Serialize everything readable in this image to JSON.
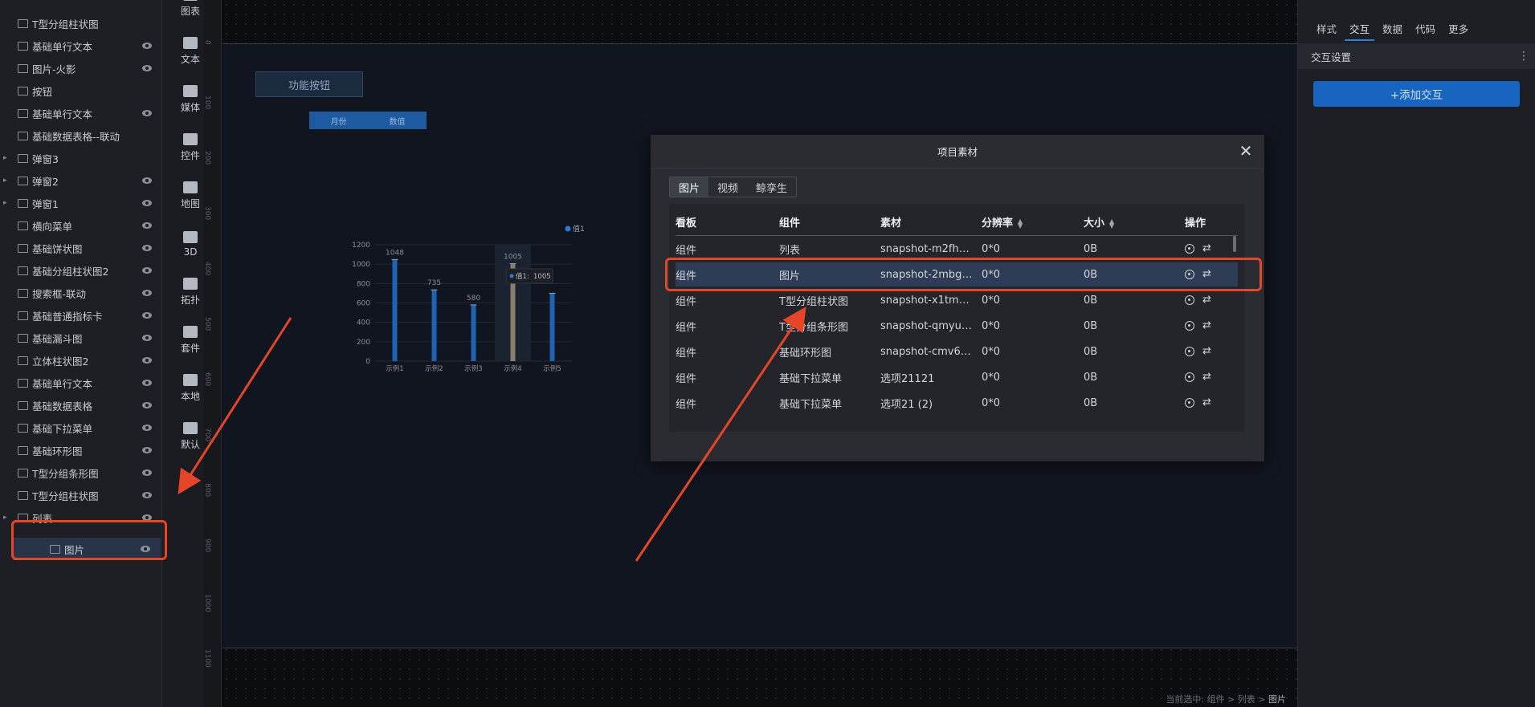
{
  "layers": [
    {
      "label": "T型分组柱状图",
      "icon": "bar-chart-icon",
      "eye": false,
      "caret": false
    },
    {
      "label": "基础单行文本",
      "icon": "text-icon",
      "eye": true,
      "caret": false
    },
    {
      "label": "图片-火影",
      "icon": "image-icon",
      "eye": true,
      "caret": false
    },
    {
      "label": "按钮",
      "icon": "button-icon",
      "eye": false,
      "caret": false
    },
    {
      "label": "基础单行文本",
      "icon": "text-icon",
      "eye": true,
      "caret": false
    },
    {
      "label": "基础数据表格--联动",
      "icon": "table-icon",
      "eye": false,
      "caret": false
    },
    {
      "label": "弹窗3",
      "icon": "folder-icon",
      "eye": false,
      "caret": true
    },
    {
      "label": "弹窗2",
      "icon": "folder-icon",
      "eye": true,
      "caret": true
    },
    {
      "label": "弹窗1",
      "icon": "folder-icon",
      "eye": true,
      "caret": true
    },
    {
      "label": "横向菜单",
      "icon": "menu-icon",
      "eye": true,
      "caret": false
    },
    {
      "label": "基础饼状图",
      "icon": "pie-chart-icon",
      "eye": true,
      "caret": false
    },
    {
      "label": "基础分组柱状图2",
      "icon": "bar-chart-icon",
      "eye": true,
      "caret": false
    },
    {
      "label": "搜索框-联动",
      "icon": "search-box-icon",
      "eye": true,
      "caret": false
    },
    {
      "label": "基础普通指标卡",
      "icon": "indicator-card-icon",
      "eye": true,
      "caret": false
    },
    {
      "label": "基础漏斗图",
      "icon": "funnel-chart-icon",
      "eye": true,
      "caret": false
    },
    {
      "label": "立体柱状图2",
      "icon": "3d-bar-icon",
      "eye": true,
      "caret": false
    },
    {
      "label": "基础单行文本",
      "icon": "text-icon",
      "eye": true,
      "caret": false
    },
    {
      "label": "基础数据表格",
      "icon": "table-icon",
      "eye": true,
      "caret": false
    },
    {
      "label": "基础下拉菜单",
      "icon": "dropdown-icon",
      "eye": true,
      "caret": false
    },
    {
      "label": "基础环形图",
      "icon": "ring-chart-icon",
      "eye": true,
      "caret": false
    },
    {
      "label": "T型分组条形图",
      "icon": "hbar-chart-icon",
      "eye": true,
      "caret": false
    },
    {
      "label": "T型分组柱状图",
      "icon": "bar-chart-icon",
      "eye": true,
      "caret": false
    },
    {
      "label": "列表",
      "icon": "list-icon",
      "eye": true,
      "caret": true
    },
    {
      "label": "图片",
      "icon": "image-icon",
      "eye": true,
      "caret": false,
      "selected": true
    }
  ],
  "rail": [
    {
      "label": "图表",
      "icon": "chart-icon"
    },
    {
      "label": "文本",
      "icon": "crown-icon"
    },
    {
      "label": "媒体",
      "icon": "media-icon"
    },
    {
      "label": "控件",
      "icon": "control-icon"
    },
    {
      "label": "地图",
      "icon": "map-icon"
    },
    {
      "label": "3D",
      "icon": "cube-icon"
    },
    {
      "label": "拓扑",
      "icon": "topology-icon"
    },
    {
      "label": "套件",
      "icon": "shirt-icon"
    },
    {
      "label": "本地",
      "icon": "puzzle-icon"
    },
    {
      "label": "默认",
      "icon": "bar-icon"
    }
  ],
  "ruler": [
    "0",
    "100",
    "200",
    "300",
    "400",
    "500",
    "600",
    "700",
    "800",
    "900",
    "1000",
    "1100"
  ],
  "canvas": {
    "func_button": "功能按钮",
    "table_headers": [
      "月份",
      "数值"
    ],
    "mini_chart": {
      "legend": "值1",
      "y_ticks": [
        "0",
        "200",
        "400",
        "600",
        "800",
        "1000",
        "1200"
      ],
      "tooltip_label": "值1:",
      "tooltip_value": "1005"
    }
  },
  "chart_data": {
    "type": "bar",
    "categories": [
      "示例1",
      "示例2",
      "示例3",
      "示例4",
      "示例5"
    ],
    "values": [
      1048,
      735,
      580,
      1005,
      700
    ],
    "data_labels": [
      "1048",
      "735",
      "580",
      "1005",
      ""
    ],
    "ylim": [
      0,
      1200
    ],
    "series": [
      {
        "name": "值1",
        "values": [
          1048,
          735,
          580,
          1005,
          700
        ]
      }
    ]
  },
  "props": {
    "tabs": [
      "样式",
      "交互",
      "数据",
      "代码",
      "更多"
    ],
    "active_tab": "交互",
    "section": "交互设置",
    "add_button": "+添加交互"
  },
  "modal": {
    "title": "项目素材",
    "seg_tabs": [
      "图片",
      "视频",
      "鲸孪生"
    ],
    "columns": [
      "看板",
      "组件",
      "素材",
      "分辨率",
      "大小",
      "操作"
    ],
    "rows": [
      {
        "board": "组件",
        "component": "列表",
        "asset": "snapshot-m2fhd...",
        "res": "0*0",
        "size": "0B"
      },
      {
        "board": "组件",
        "component": "图片",
        "asset": "snapshot-2mbgh...",
        "res": "0*0",
        "size": "0B",
        "highlight": true
      },
      {
        "board": "组件",
        "component": "T型分组柱状图",
        "asset": "snapshot-x1tm8p...",
        "res": "0*0",
        "size": "0B"
      },
      {
        "board": "组件",
        "component": "T型分组条形图",
        "asset": "snapshot-qmyuv...",
        "res": "0*0",
        "size": "0B"
      },
      {
        "board": "组件",
        "component": "基础环形图",
        "asset": "snapshot-cmv6w...",
        "res": "0*0",
        "size": "0B"
      },
      {
        "board": "组件",
        "component": "基础下拉菜单",
        "asset": "选项21121",
        "res": "0*0",
        "size": "0B"
      },
      {
        "board": "组件",
        "component": "基础下拉菜单",
        "asset": "选项21 (2)",
        "res": "0*0",
        "size": "0B"
      }
    ]
  },
  "footer": {
    "prefix": "当前选中: 组件 > 列表 > ",
    "current": "图片"
  },
  "colors": {
    "accent": "#1765bf",
    "annotation": "#e54528",
    "highlight_row": "#2e3d55"
  }
}
